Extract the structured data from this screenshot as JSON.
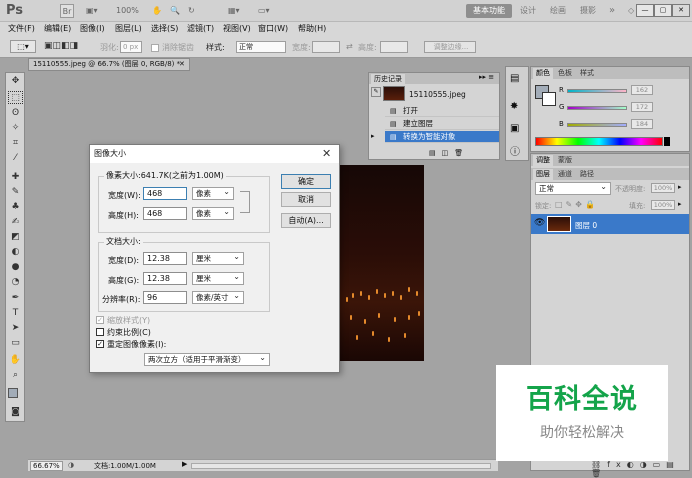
{
  "app": {
    "logo": "Ps",
    "zoom": "100%",
    "workspaces": [
      "基本功能",
      "设计",
      "绘画",
      "摄影"
    ],
    "more": "»"
  },
  "menu": [
    "文件(F)",
    "编辑(E)",
    "图像(I)",
    "图层(L)",
    "选择(S)",
    "滤镜(T)",
    "视图(V)",
    "窗口(W)",
    "帮助(H)"
  ],
  "options": {
    "feather_label": "羽化:",
    "feather_value": "0 px",
    "antialias_label": "消除锯齿",
    "style_label": "样式:",
    "style_value": "正常",
    "width_label": "宽度:",
    "height_label": "高度:",
    "refine_edge": "调整边缘..."
  },
  "document": {
    "tab_label": "15110555.jpeg @ 66.7% (图层 0, RGB/8) *",
    "zoom": "66.67%",
    "doc_info": "文档:1.00M/1.00M"
  },
  "dialog": {
    "title": "图像大小",
    "pixel_dims_label": "像素大小:641.7K(之前为1.00M)",
    "width_label": "宽度(W):",
    "width_value": "468",
    "width_unit": "像素",
    "height_label": "高度(H):",
    "height_value": "468",
    "height_unit": "像素",
    "doc_size_label": "文档大小:",
    "doc_width_label": "宽度(D):",
    "doc_width_value": "12.38",
    "doc_width_unit": "厘米",
    "doc_height_label": "高度(G):",
    "doc_height_value": "12.38",
    "doc_height_unit": "厘米",
    "resolution_label": "分辨率(R):",
    "resolution_value": "96",
    "resolution_unit": "像素/英寸",
    "scale_styles_label": "缩放样式(Y)",
    "constrain_label": "约束比例(C)",
    "resample_label": "重定图像像素(I):",
    "resample_method": "两次立方（适用于平滑渐变）",
    "ok_label": "确定",
    "cancel_label": "取消",
    "auto_label": "自动(A)..."
  },
  "history": {
    "title": "历史记录",
    "snapshot_label": "15110555.jpeg",
    "items": [
      "打开",
      "建立图层",
      "转换为智能对象"
    ]
  },
  "color_panel": {
    "tabs": [
      "颜色",
      "色板",
      "样式"
    ],
    "r": "162",
    "g": "172",
    "b": "184",
    "fg_color": "#a2acb8"
  },
  "layers_panel": {
    "tabs": [
      "图层",
      "通道",
      "路径"
    ],
    "top_tabs": [
      "调整",
      "蒙版"
    ],
    "blend_mode": "正常",
    "opacity_label": "不透明度:",
    "opacity_value": "100%",
    "lock_label": "锁定:",
    "fill_label": "填充:",
    "fill_value": "100%",
    "layer_name": "图层 0"
  },
  "watermark": {
    "main": "百科全说",
    "sub": "助你轻松解决"
  }
}
